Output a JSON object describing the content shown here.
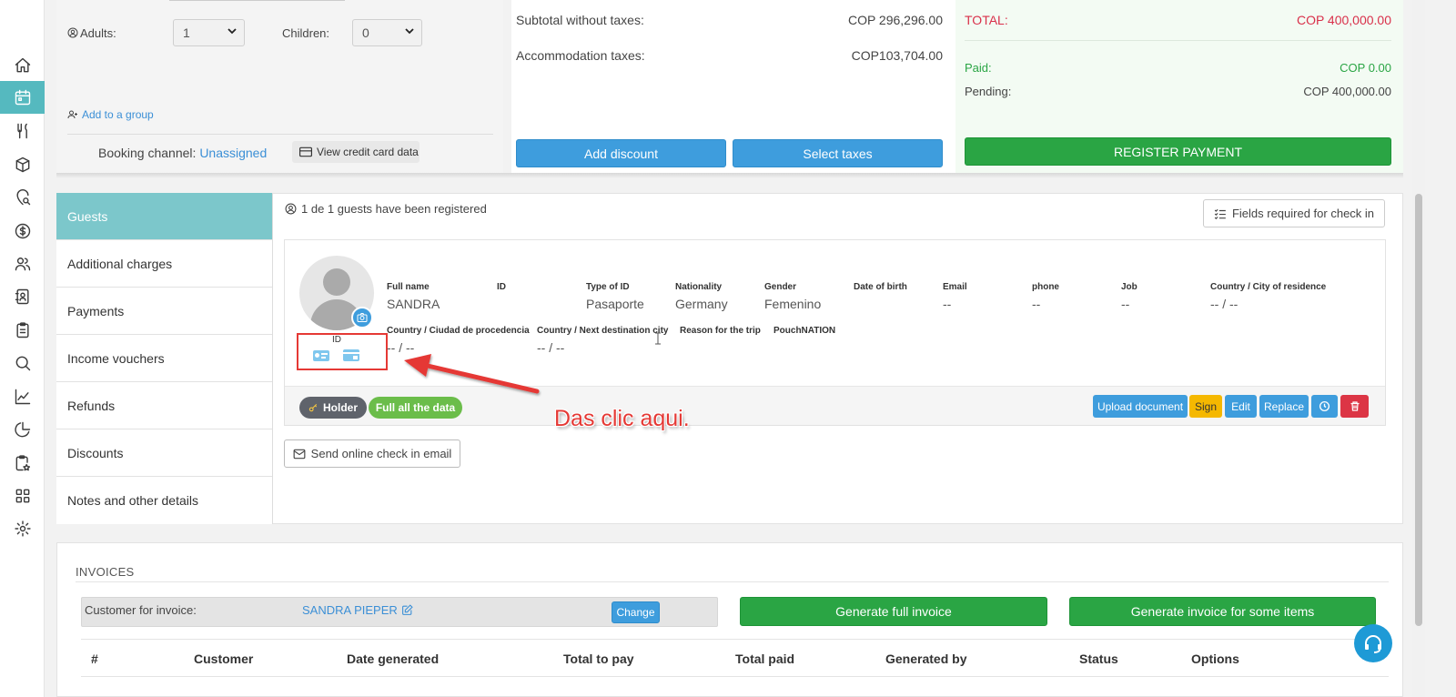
{
  "sidebar": {
    "items": [
      {
        "icon": "home-icon"
      },
      {
        "icon": "calendar-icon",
        "active": true
      },
      {
        "icon": "restaurant-icon"
      },
      {
        "icon": "package-icon"
      },
      {
        "icon": "location-search-icon"
      },
      {
        "icon": "dollar-icon"
      },
      {
        "icon": "users-icon"
      },
      {
        "icon": "contacts-book-icon"
      },
      {
        "icon": "clipboard-icon"
      },
      {
        "icon": "search-icon"
      },
      {
        "icon": "line-chart-icon"
      },
      {
        "icon": "pie-chart-icon"
      },
      {
        "icon": "clipboard-star-icon"
      },
      {
        "icon": "grid-apps-icon"
      },
      {
        "icon": "gear-icon"
      }
    ]
  },
  "booking": {
    "adults_label": "Adults:",
    "adults_value": "1",
    "children_label": "Children:",
    "children_value": "0",
    "add_group": "Add to a group",
    "channel_label": "Booking channel:",
    "channel_value": "Unassigned",
    "view_card": "View credit card data"
  },
  "totals": {
    "subtotal_label": "Subtotal without taxes:",
    "subtotal_value": "COP 296,296.00",
    "taxes_label": "Accommodation taxes:",
    "taxes_value": "COP103,704.00",
    "add_discount": "Add discount",
    "select_taxes": "Select taxes",
    "total_label": "TOTAL:",
    "total_value": "COP 400,000.00",
    "paid_label": "Paid:",
    "paid_value": "COP 0.00",
    "pending_label": "Pending:",
    "pending_value": "COP 400,000.00",
    "register_payment": "REGISTER PAYMENT",
    "colors": {
      "total": "#d9304a",
      "paid": "#2aa544"
    }
  },
  "tabs": [
    "Guests",
    "Additional charges",
    "Payments",
    "Income vouchers",
    "Refunds",
    "Discounts",
    "Notes and other details"
  ],
  "guests": {
    "registered": "1 de 1 guests have been registered",
    "fields_required": "Fields required for check in",
    "id_label": "ID",
    "row1": [
      {
        "label": "Full name",
        "value": "SANDRA"
      },
      {
        "label": "ID",
        "value": ""
      },
      {
        "label": "Type of ID",
        "value": "Pasaporte"
      },
      {
        "label": "Nationality",
        "value": "Germany"
      },
      {
        "label": "Gender",
        "value": "Femenino"
      },
      {
        "label": "Date of birth",
        "value": ""
      },
      {
        "label": "Email",
        "value": "--"
      },
      {
        "label": "phone",
        "value": "--"
      },
      {
        "label": "Job",
        "value": "--"
      },
      {
        "label": "Country / City of residence",
        "value": "-- / --"
      }
    ],
    "row2": [
      {
        "label": "Country / Ciudad de procedencia",
        "value": "-- / --"
      },
      {
        "label": "Country / Next destination city",
        "value": "-- / --"
      },
      {
        "label": "Reason for the trip",
        "value": ""
      },
      {
        "label": "PouchNATION",
        "value": ""
      }
    ],
    "holder": "Holder",
    "full_data": "Full all the data",
    "upload_document": "Upload document",
    "sign": "Sign",
    "edit": "Edit",
    "replace": "Replace",
    "send_email": "Send online check in email"
  },
  "annotation": {
    "text": "Das clic aqui."
  },
  "invoices": {
    "title": "INVOICES",
    "customer_label": "Customer for invoice:",
    "customer_name": "SANDRA PIEPER",
    "change": "Change",
    "generate_full": "Generate full invoice",
    "generate_some": "Generate invoice for some items",
    "columns": [
      "#",
      "Customer",
      "Date generated",
      "Total to pay",
      "Total paid",
      "Generated by",
      "Status",
      "Options"
    ]
  }
}
